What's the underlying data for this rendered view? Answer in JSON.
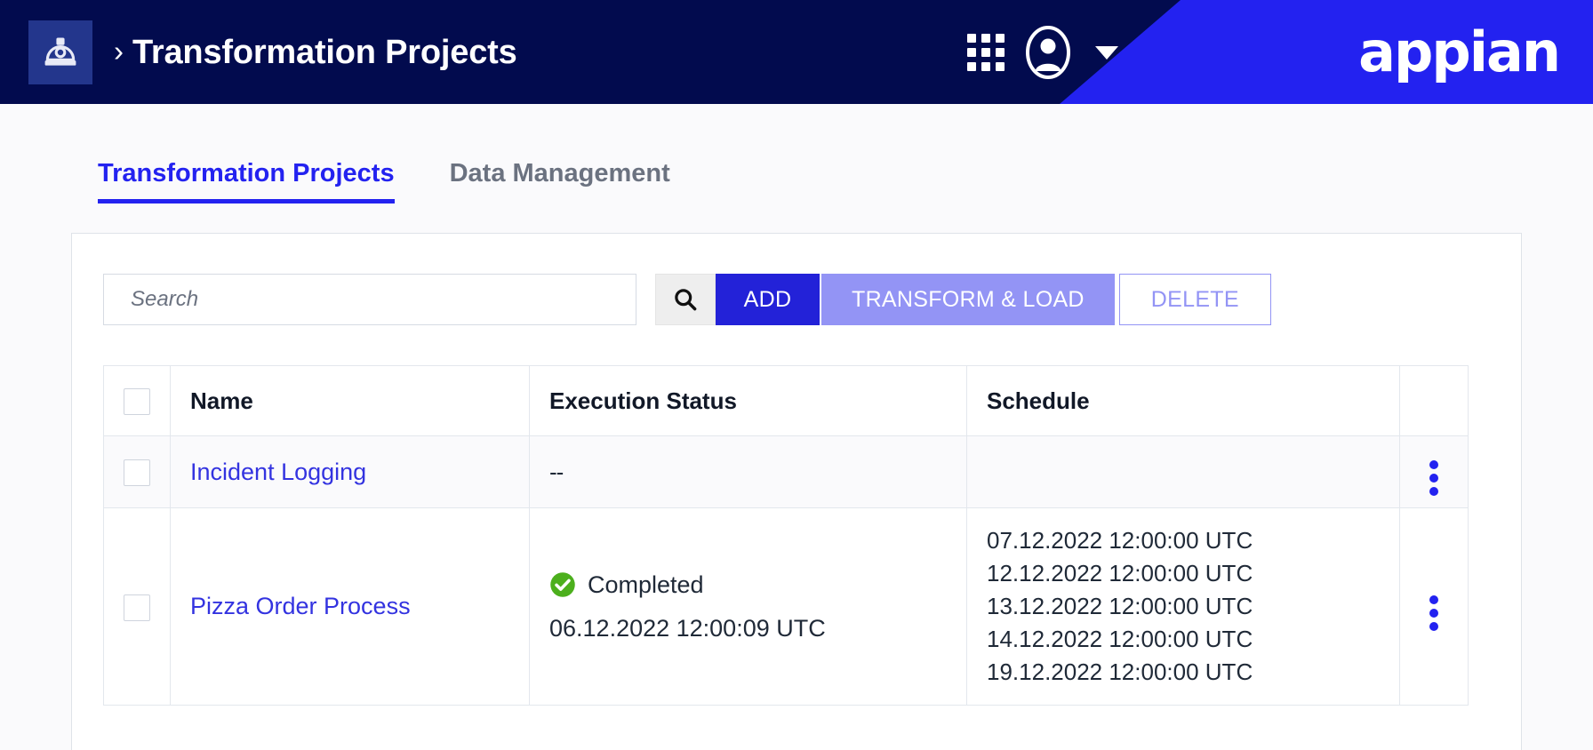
{
  "header": {
    "app_icon": "hard-hat-icon",
    "breadcrumb_chevron": "›",
    "title": "Transformation Projects",
    "grid_icon": "apps-grid-icon",
    "avatar_icon": "user-avatar-icon",
    "caret_icon": "chevron-down-icon",
    "brand": "appian",
    "bg_color": "#020b4e",
    "brand_color": "#2322f0"
  },
  "tabs": [
    {
      "label": "Transformation Projects",
      "active": true
    },
    {
      "label": "Data Management",
      "active": false
    }
  ],
  "toolbar": {
    "search_placeholder": "Search",
    "search_value": "",
    "search_icon": "search-icon",
    "add_label": "ADD",
    "transform_load_label": "TRANSFORM & LOAD",
    "delete_label": "DELETE",
    "add_color": "#2322d8",
    "transform_color": "#9394f5",
    "delete_color": "#9394f5"
  },
  "table": {
    "select_all_checkbox": false,
    "headers": [
      "",
      "Name",
      "Execution Status",
      "Schedule",
      ""
    ],
    "rows": [
      {
        "checked": false,
        "name": "Incident Logging",
        "status_icon": "",
        "status_text": "--",
        "status_time": "",
        "schedule": [],
        "menu_icon": "kebab-menu-icon"
      },
      {
        "checked": false,
        "name": "Pizza Order Process",
        "status_icon": "check-circle-icon",
        "status_text": "Completed",
        "status_time": "06.12.2022 12:00:09 UTC",
        "schedule": [
          "07.12.2022 12:00:00 UTC",
          "12.12.2022 12:00:00 UTC",
          "13.12.2022 12:00:00 UTC",
          "14.12.2022 12:00:00 UTC",
          "19.12.2022 12:00:00 UTC"
        ],
        "menu_icon": "kebab-menu-icon"
      }
    ],
    "status_success_color": "#4caf1d"
  }
}
